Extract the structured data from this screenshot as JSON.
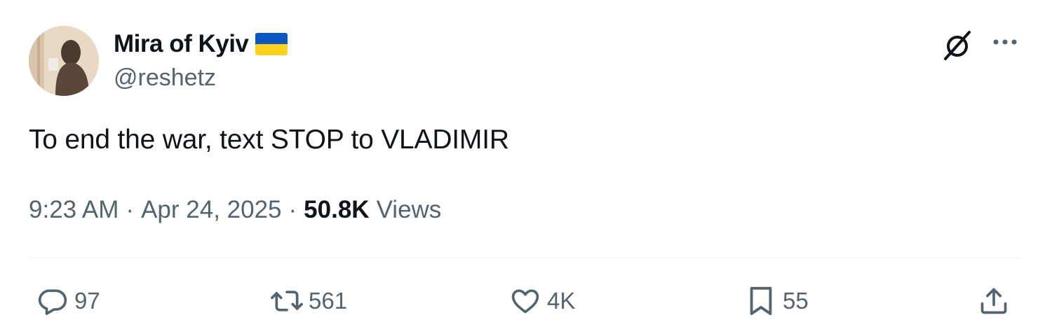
{
  "author": {
    "display_name": "Mira of Kyiv",
    "handle": "@reshetz",
    "flag": {
      "colors": [
        "#0a57c2",
        "#ffd21f"
      ]
    }
  },
  "header_actions": {
    "grok_icon": "grok-icon",
    "more_icon": "more-icon"
  },
  "tweet": {
    "text": "To end the war, text STOP to VLADIMIR",
    "time": "9:23 AM",
    "date": "Apr 24, 2025",
    "separator": "·",
    "views_count": "50.8K",
    "views_label": "Views"
  },
  "actions": {
    "reply": {
      "icon": "reply-icon",
      "count": "97"
    },
    "retweet": {
      "icon": "retweet-icon",
      "count": "561"
    },
    "like": {
      "icon": "heart-icon",
      "count": "4K"
    },
    "bookmark": {
      "icon": "bookmark-icon",
      "count": "55"
    },
    "share": {
      "icon": "share-icon"
    }
  },
  "colors": {
    "text_primary": "#0f1419",
    "text_secondary": "#536471",
    "divider": "#eff3f4"
  }
}
